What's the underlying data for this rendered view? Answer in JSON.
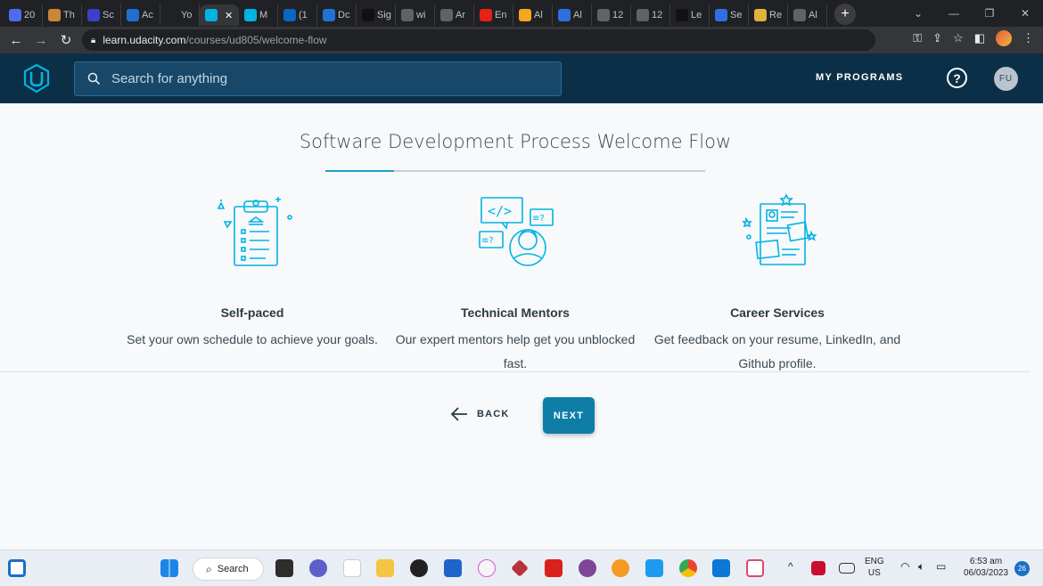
{
  "browser": {
    "tabs": [
      {
        "label": "20",
        "color": "#4f6bed"
      },
      {
        "label": "Th",
        "color": "#c9873b"
      },
      {
        "label": "Sc",
        "color": "#3b3fc9"
      },
      {
        "label": "Ac",
        "color": "#1f6fd1"
      },
      {
        "label": "Yo",
        "color": "#202124"
      },
      {
        "label": "",
        "color": "#02b3e4",
        "active": true
      },
      {
        "label": "M",
        "color": "#02b3e4"
      },
      {
        "label": "(1",
        "color": "#0a66c2"
      },
      {
        "label": "Dc",
        "color": "#1e73d6"
      },
      {
        "label": "Sig",
        "color": "#111111"
      },
      {
        "label": "wi",
        "color": "#5f6368"
      },
      {
        "label": "Ar",
        "color": "#5f6368"
      },
      {
        "label": "En",
        "color": "#e62117"
      },
      {
        "label": "Al",
        "color": "#f5a623"
      },
      {
        "label": "Al",
        "color": "#2f6fe0"
      },
      {
        "label": "12",
        "color": "#5f6368"
      },
      {
        "label": "12",
        "color": "#5f6368"
      },
      {
        "label": "Le",
        "color": "#111111"
      },
      {
        "label": "Se",
        "color": "#2f6fe0"
      },
      {
        "label": "Re",
        "color": "#e0b43a"
      },
      {
        "label": "Al",
        "color": "#5f6368"
      }
    ],
    "url_host": "learn.udacity.com",
    "url_path": "/courses/ud805/welcome-flow"
  },
  "header": {
    "search_placeholder": "Search for anything",
    "my_programs": "MY PROGRAMS",
    "help": "?",
    "avatar_initials": "FU"
  },
  "main": {
    "title": "Software Development Process Welcome Flow",
    "progress_fraction": 0.18,
    "features": [
      {
        "icon": "clipboard-checklist-icon",
        "heading": "Self-paced",
        "description": "Set your own schedule to achieve your goals."
      },
      {
        "icon": "mentor-chat-icon",
        "heading": "Technical Mentors",
        "description": "Our expert mentors help get you unblocked fast."
      },
      {
        "icon": "resume-document-icon",
        "heading": "Career Services",
        "description": "Get feedback on your resume, LinkedIn, and Github profile."
      }
    ],
    "back_label": "BACK",
    "next_label": "NEXT"
  },
  "taskbar": {
    "search_label": "Search",
    "lang_top": "ENG",
    "lang_bottom": "US",
    "time": "6:53 am",
    "date": "06/03/2023",
    "notifications": "26"
  },
  "colors": {
    "header_bg": "#0b2f47",
    "accent": "#02b3e4",
    "next_button": "#0e7ea6"
  }
}
